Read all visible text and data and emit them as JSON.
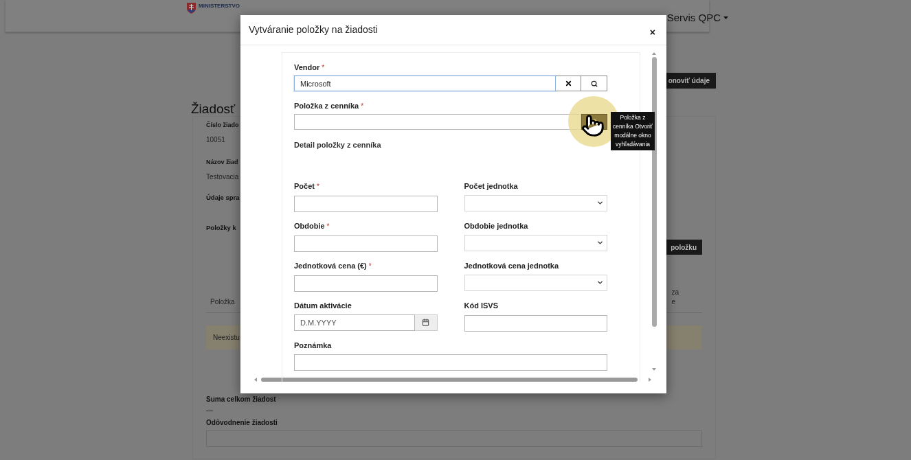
{
  "header": {
    "logo_text": "MINISTERSTVO",
    "nav": [
      {
        "label": "Servis QPC",
        "dropdown": true
      }
    ]
  },
  "page": {
    "refresh_button": "onoviť údaje",
    "title": "Žiadosť",
    "fields": [
      {
        "label": "Číslo žiado",
        "value": "10051"
      },
      {
        "label": "Názov žiad",
        "value": "Testovacia"
      }
    ],
    "section_1": "Údaje spra",
    "section_2": "Položky k",
    "add_button": "položku",
    "table_columns": [
      "Položka",
      "za",
      "e"
    ],
    "alert": "Neexistu",
    "total_label": "Suma celkom žiadost",
    "total_value": "—",
    "reason_label": "Odôvodnenie žiadosti"
  },
  "modal": {
    "title": "Vytváranie položky na žiadosti",
    "close": "×",
    "lookups": [
      {
        "label": "Vendor",
        "required_mark": "*",
        "value": "Microsoft",
        "focused": true,
        "clear_button": true,
        "highlighted": false
      },
      {
        "label": "Položka z cenníka",
        "required_mark": "*",
        "focused": false,
        "clear_button": false,
        "highlighted": true,
        "tooltip": "Položka z cenníka Otvoriť modálne okno vyhľadávania"
      }
    ],
    "detail_heading": "Detail položky z cenníka",
    "grid_fields": [
      {
        "kind": "text",
        "label": "Počet",
        "required_mark": "*"
      },
      {
        "kind": "select",
        "label": "Počet jednotka"
      },
      {
        "kind": "text",
        "label": "Obdobie",
        "required_mark": "*"
      },
      {
        "kind": "select",
        "label": "Obdobie jednotka"
      },
      {
        "kind": "text",
        "label": "Jednotková cena (€)",
        "required_mark": "*"
      },
      {
        "kind": "select",
        "label": "Jednotková cena jednotka"
      },
      {
        "kind": "date",
        "label": "Dátum aktivácie",
        "placeholder": "D.M.YYYY"
      },
      {
        "kind": "text",
        "label": "Kód ISVS"
      }
    ],
    "note_field": {
      "label": "Poznámka"
    }
  }
}
